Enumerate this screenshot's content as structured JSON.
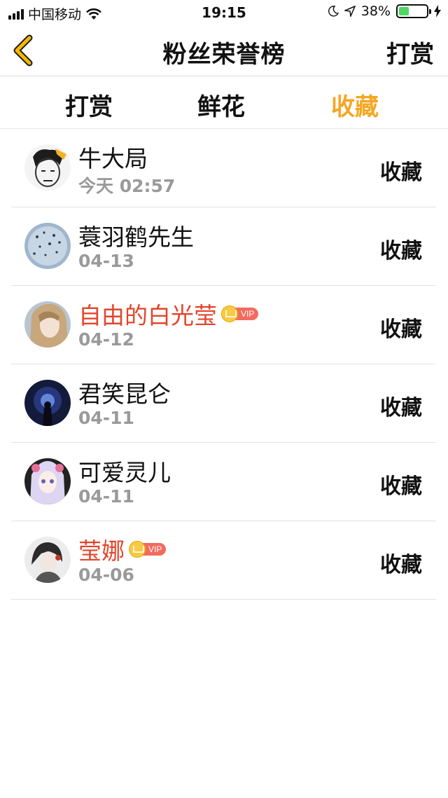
{
  "status_bar": {
    "carrier": "中国移动",
    "time": "19:15",
    "battery_percent": "38%",
    "battery_level": 0.38,
    "icons": [
      "signal-icon",
      "wifi-icon",
      "moon-icon",
      "location-arrow-icon",
      "battery-icon",
      "charging-bolt-icon"
    ]
  },
  "nav": {
    "title": "粉丝荣誉榜",
    "right_label": "打赏",
    "back_icon": "chevron-left-icon"
  },
  "tabs": [
    {
      "label": "打赏",
      "active": false
    },
    {
      "label": "鲜花",
      "active": false
    },
    {
      "label": "收藏",
      "active": true
    }
  ],
  "colors": {
    "accent": "#f5a623",
    "vip_name": "#e2452b",
    "back_icon": "#f5b800",
    "date_text": "#9a9a9a"
  },
  "fans": [
    {
      "name": "牛大局",
      "date": "今天 02:57",
      "action": "收藏",
      "vip": false
    },
    {
      "name": "蓑羽鹤先生",
      "date": "04-13",
      "action": "收藏",
      "vip": false
    },
    {
      "name": "自由的白光莹",
      "date": "04-12",
      "action": "收藏",
      "vip": true,
      "vip_label": "VIP"
    },
    {
      "name": "君笑昆仑",
      "date": "04-11",
      "action": "收藏",
      "vip": false
    },
    {
      "name": "可爱灵儿",
      "date": "04-11",
      "action": "收藏",
      "vip": false
    },
    {
      "name": "莹娜",
      "date": "04-06",
      "action": "收藏",
      "vip": true,
      "vip_label": "VIP"
    }
  ]
}
